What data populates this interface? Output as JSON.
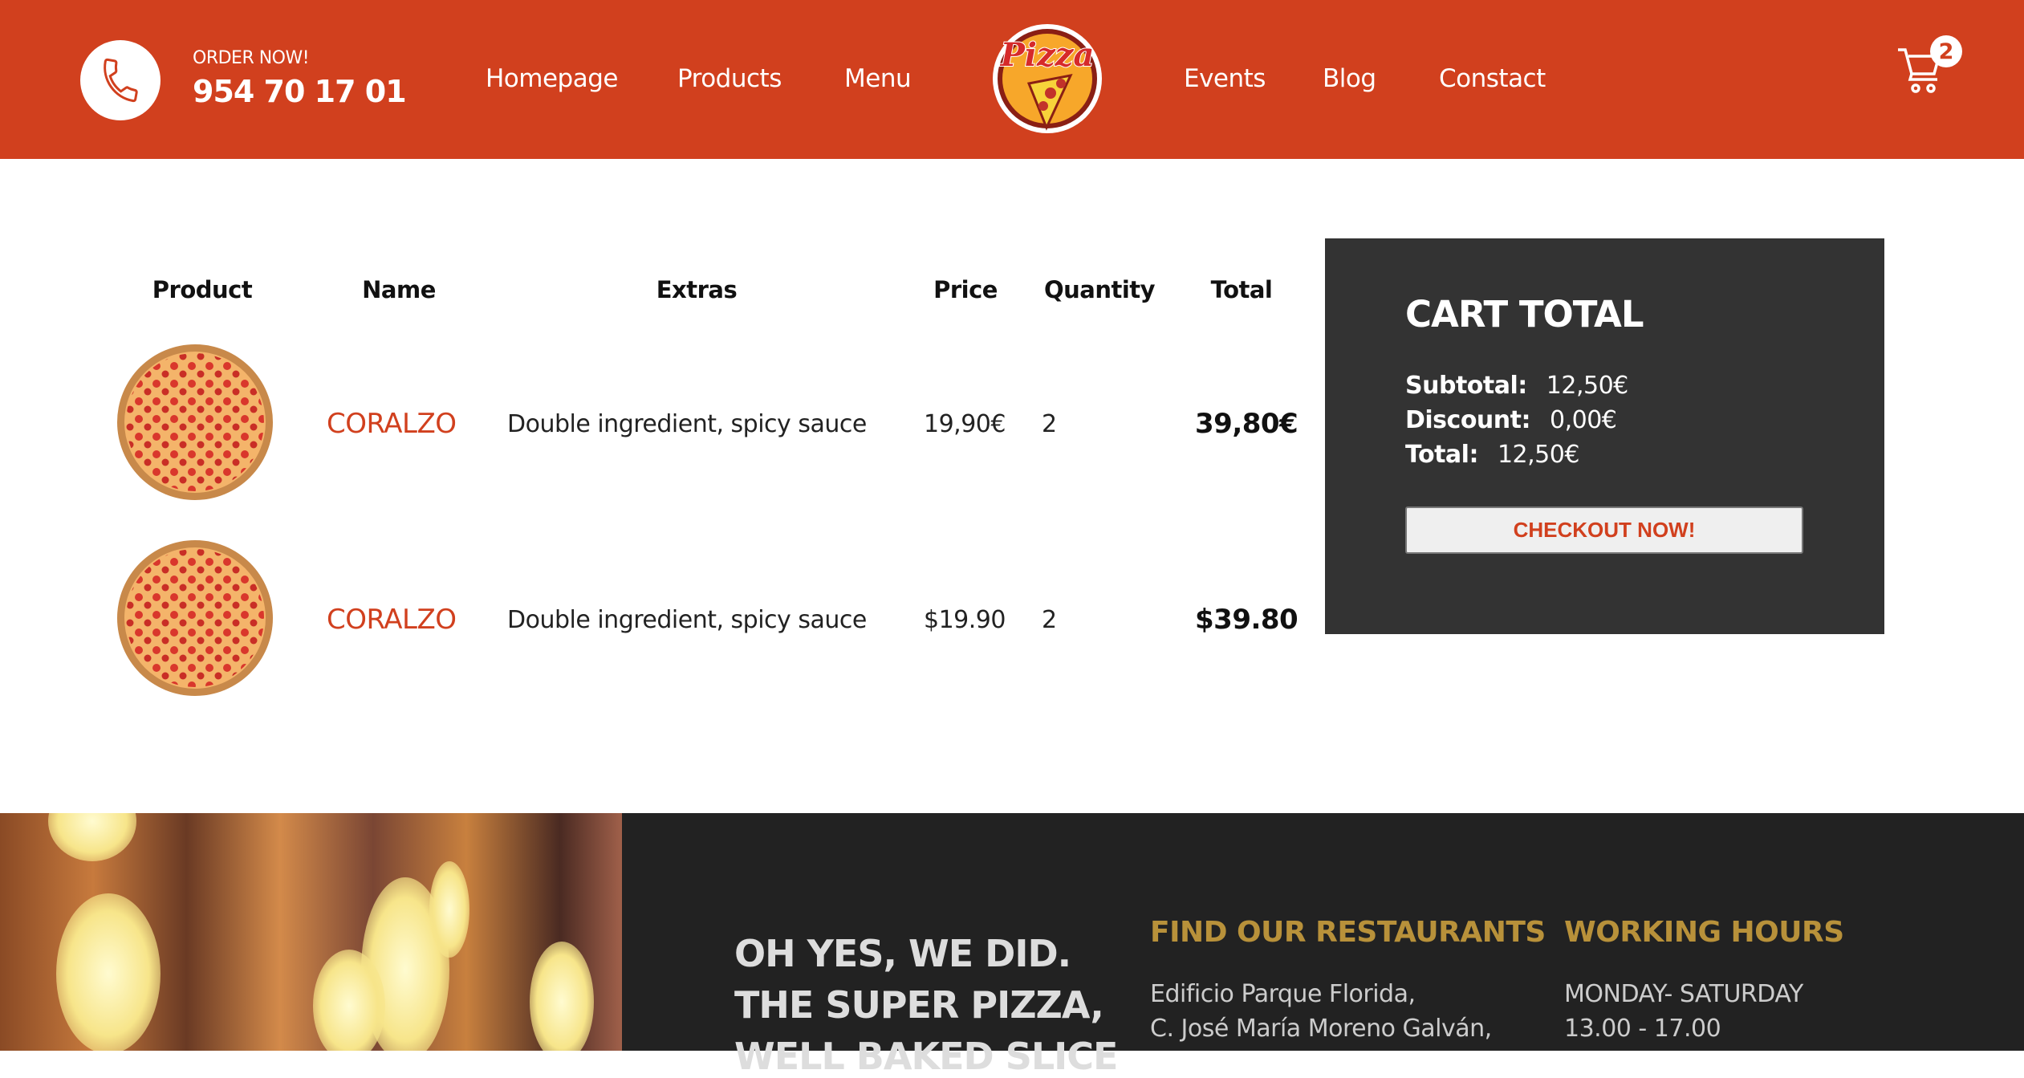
{
  "header": {
    "order_label": "ORDER NOW!",
    "phone": "954 70 17 01",
    "nav": [
      "Homepage",
      "Products",
      "Menu",
      "Events",
      "Blog",
      "Constact"
    ],
    "logo_text": "Pizza",
    "cart_count": "2"
  },
  "table": {
    "headers": [
      "Product",
      "Name",
      "Extras",
      "Price",
      "Quantity",
      "Total"
    ],
    "rows": [
      {
        "name": "CORALZO",
        "extras": "Double ingredient, spicy sauce",
        "price": "19,90€",
        "quantity": "2",
        "total": "39,80€"
      },
      {
        "name": "CORALZO",
        "extras": "Double ingredient, spicy sauce",
        "price": "$19.90",
        "quantity": "2",
        "total": "$39.80"
      }
    ]
  },
  "cart_total": {
    "title": "CART TOTAL",
    "subtotal_label": "Subtotal:",
    "subtotal": "12,50€",
    "discount_label": "Discount:",
    "discount": "0,00€",
    "total_label": "Total:",
    "total": "12,50€",
    "checkout": "CHECKOUT NOW!"
  },
  "footer": {
    "tagline": [
      "OH YES, WE DID.",
      "THE SUPER PIZZA,",
      "WELL BAKED SLICE"
    ],
    "restaurants_title": "FIND OUR RESTAURANTS",
    "address": [
      "Edificio Parque Florida,",
      "C. José María Moreno Galván,"
    ],
    "hours_title": "WORKING HOURS",
    "hours": [
      "MONDAY- SATURDAY",
      "13.00 - 17.00"
    ]
  },
  "colors": {
    "brand": "#d1401e",
    "dark": "#333333",
    "footer": "#222222",
    "gold": "#b8913a"
  }
}
